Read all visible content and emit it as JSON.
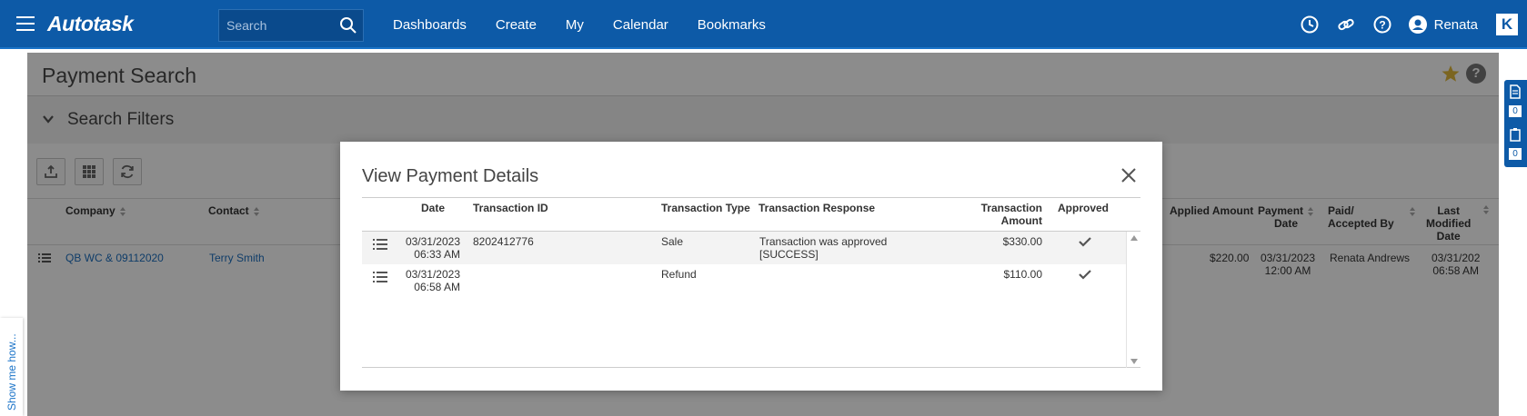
{
  "topbar": {
    "logo": "Autotask",
    "search_placeholder": "Search",
    "nav": [
      "Dashboards",
      "Create",
      "My",
      "Calendar",
      "Bookmarks"
    ],
    "user": "Renata",
    "k_badge": "K"
  },
  "page": {
    "title": "Payment Search",
    "filters_label": "Search Filters",
    "columns": {
      "company": "Company",
      "contact": "Contact",
      "applied_amount": "Applied Amount",
      "payment_date": [
        "Payment",
        "Date"
      ],
      "paid_accepted_by": [
        "Paid/",
        "Accepted By"
      ],
      "last_modified": [
        "Last",
        "Modified",
        "Date"
      ]
    },
    "row": {
      "company": "QB WC & 09112020",
      "contact": "Terry Smith",
      "applied_amount": "$220.00",
      "payment_date": [
        "03/31/2023",
        "12:00 AM"
      ],
      "paid_by": "Renata Andrews",
      "last_modified": [
        "03/31/202",
        "06:58 AM"
      ]
    }
  },
  "left_tab": "Show me how...",
  "right_panel": {
    "count1": "0",
    "count2": "0"
  },
  "modal": {
    "title": "View Payment Details",
    "headers": {
      "date": "Date",
      "transaction_id": "Transaction ID",
      "transaction_type": "Transaction Type",
      "transaction_response": "Transaction Response",
      "transaction_amount": [
        "Transaction",
        "Amount"
      ],
      "approved": "Approved"
    },
    "rows": [
      {
        "date": [
          "03/31/2023",
          "06:33 AM"
        ],
        "transaction_id": "8202412776",
        "type": "Sale",
        "response": [
          "Transaction was approved",
          "[SUCCESS]"
        ],
        "amount": "$330.00",
        "approved": true
      },
      {
        "date": [
          "03/31/2023",
          "06:58 AM"
        ],
        "transaction_id": "",
        "type": "Refund",
        "response": [
          "",
          ""
        ],
        "amount": "$110.00",
        "approved": true
      }
    ]
  }
}
